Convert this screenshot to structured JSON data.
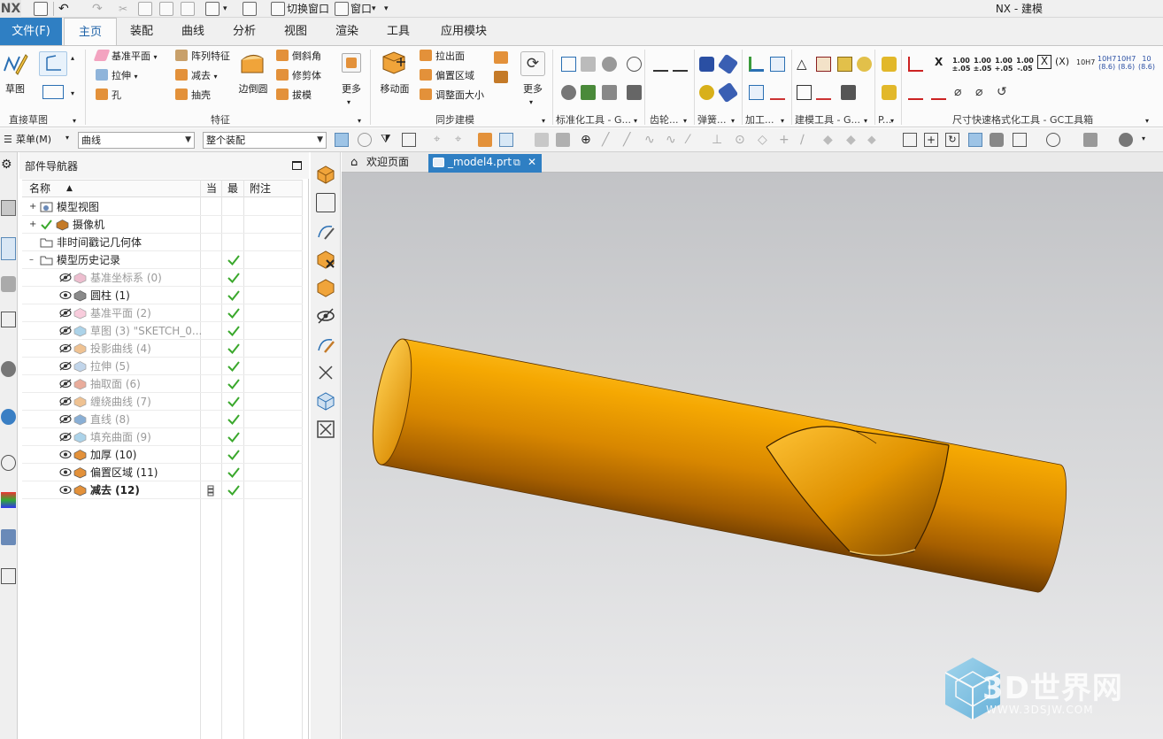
{
  "app": {
    "logo": "NX",
    "window_title": "NX - 建模",
    "quick_access": {
      "switch_window": "切换窗口",
      "window_menu": "窗口"
    }
  },
  "ribbon": {
    "file_tab": "文件(F)",
    "tabs": [
      "主页",
      "装配",
      "曲线",
      "分析",
      "视图",
      "渲染",
      "工具",
      "应用模块"
    ],
    "active_tab": "主页",
    "groups": {
      "direct_sketch": {
        "label": "直接草图",
        "sketch": "草图"
      },
      "feature": {
        "label": "特征",
        "datum_plane": "基准平面",
        "extrude": "拉伸",
        "hole": "孔",
        "pattern_feature": "阵列特征",
        "subtract": "减去",
        "shell": "抽壳",
        "edge_blend": "边倒圆",
        "chamfer": "倒斜角",
        "trim_body": "修剪体",
        "draft": "拔模",
        "more": "更多"
      },
      "sync_modeling": {
        "label": "同步建模",
        "move_face": "移动面",
        "pull_face": "拉出面",
        "offset_region": "偏置区域",
        "resize_face": "调整面大小",
        "more": "更多"
      },
      "standard_tools": {
        "label": "标准化工具 - G..."
      },
      "gear": {
        "label": "齿轮..."
      },
      "spring": {
        "label": "弹簧..."
      },
      "machining": {
        "label": "加工..."
      },
      "modeling_tools": {
        "label": "建模工具 - G..."
      },
      "p_group": {
        "label": "P..."
      },
      "dimension_format": {
        "label": "尺寸快速格式化工具 - GC工具箱",
        "tol_labels": [
          "1.00\n±.05",
          "1.00\n±.05",
          "1.00\n+.05",
          "1.00\n-.05",
          "X",
          "(X)",
          "10H7",
          "10H7\n(8.6)",
          "10H7\n(8.6)",
          "10\n(8.6)",
          "10H7"
        ]
      }
    }
  },
  "command_bar": {
    "menu": "菜单(M)",
    "selection_filter": "曲线",
    "selection_scope": "整个装配"
  },
  "part_navigator": {
    "title": "部件导航器",
    "columns": {
      "name": "名称",
      "current": "当",
      "latest": "最",
      "notes": "附注"
    },
    "rows": [
      {
        "label": "模型视图",
        "level": 0,
        "expander": "+",
        "icon": "model-views-icon",
        "dim": false,
        "bold": false,
        "check": false
      },
      {
        "label": "摄像机",
        "level": 0,
        "expander": "+",
        "icon": "camera-icon",
        "dim": false,
        "bold": false,
        "check": false
      },
      {
        "label": "非时间戳记几何体",
        "level": 0,
        "expander": "",
        "icon": "folder-icon",
        "dim": false,
        "bold": false,
        "check": false
      },
      {
        "label": "模型历史记录",
        "level": 0,
        "expander": "-",
        "icon": "folder-open-icon",
        "dim": false,
        "bold": false,
        "check": true
      },
      {
        "label": "基准坐标系 (0)",
        "level": 1,
        "icon": "datum-csys-icon",
        "dim": true,
        "bold": false,
        "check": true
      },
      {
        "label": "圆柱 (1)",
        "level": 1,
        "icon": "cylinder-icon",
        "dim": false,
        "bold": false,
        "check": true
      },
      {
        "label": "基准平面 (2)",
        "level": 1,
        "icon": "datum-plane-icon",
        "dim": true,
        "bold": false,
        "check": true
      },
      {
        "label": "草图 (3) \"SKETCH_0...",
        "level": 1,
        "icon": "sketch-icon",
        "dim": true,
        "bold": false,
        "check": true
      },
      {
        "label": "投影曲线 (4)",
        "level": 1,
        "icon": "projected-curve-icon",
        "dim": true,
        "bold": false,
        "check": true
      },
      {
        "label": "拉伸 (5)",
        "level": 1,
        "icon": "extrude-icon",
        "dim": true,
        "bold": false,
        "check": true
      },
      {
        "label": "抽取面 (6)",
        "level": 1,
        "icon": "extract-face-icon",
        "dim": true,
        "bold": false,
        "check": true
      },
      {
        "label": "缠绕曲线 (7)",
        "level": 1,
        "icon": "wrap-curve-icon",
        "dim": true,
        "bold": false,
        "check": true
      },
      {
        "label": "直线 (8)",
        "level": 1,
        "icon": "line-icon",
        "dim": true,
        "bold": false,
        "check": true
      },
      {
        "label": "填充曲面 (9)",
        "level": 1,
        "icon": "fill-surface-icon",
        "dim": true,
        "bold": false,
        "check": true
      },
      {
        "label": "加厚 (10)",
        "level": 1,
        "icon": "thicken-icon",
        "dim": false,
        "bold": false,
        "check": true
      },
      {
        "label": "偏置区域 (11)",
        "level": 1,
        "icon": "offset-region-icon",
        "dim": false,
        "bold": false,
        "check": true
      },
      {
        "label": "减去 (12)",
        "level": 1,
        "icon": "subtract-icon",
        "dim": false,
        "bold": true,
        "check": true,
        "current": true
      }
    ]
  },
  "document_tabs": {
    "welcome": "欢迎页面",
    "model": "_model4.prt"
  },
  "watermark": {
    "name": "3D世界网",
    "url": "WWW.3DSJW.COM"
  },
  "colors": {
    "accent": "#2f7fc3",
    "check_green": "#3aa82c",
    "solid_orange": "#f2a100"
  }
}
